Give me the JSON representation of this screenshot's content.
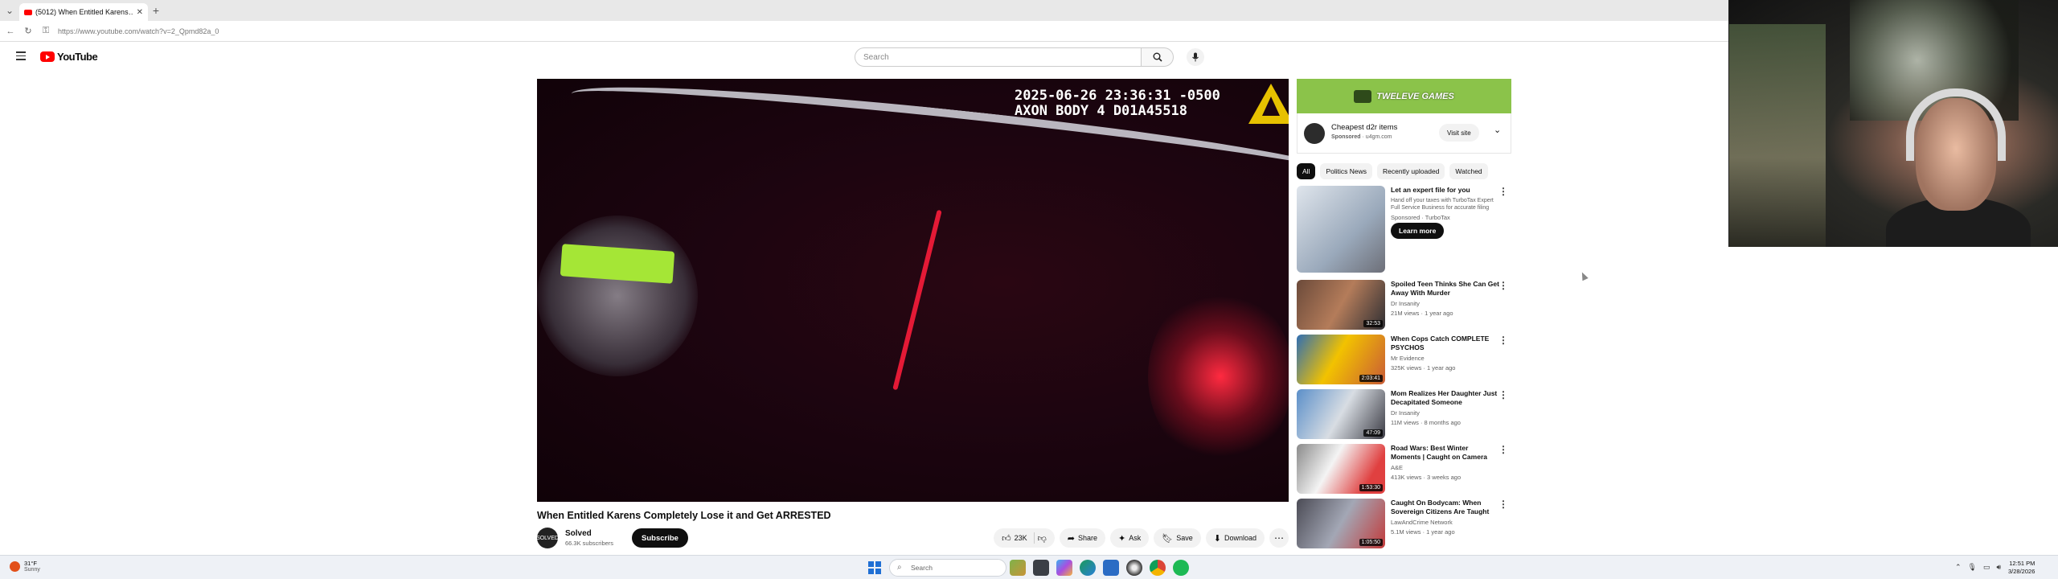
{
  "browser": {
    "tab_title": "(5012) When Entitled Karens…",
    "url": "https://www.youtube.com/watch?v=2_Qpmd82a_0"
  },
  "header": {
    "brand": "YouTube",
    "search_placeholder": "Search"
  },
  "video": {
    "overlay_line1": "2025-06-26 23:36:31 -0500",
    "overlay_line2": "AXON BODY 4 D01A45518",
    "title": "When Entitled Karens Completely Lose it and Get ARRESTED",
    "channel_avatar_text": "SOLVED",
    "channel": "Solved",
    "subscribers": "66.3K subscribers",
    "subscribe_label": "Subscribe",
    "likes": "23K",
    "share_label": "Share",
    "ask_label": "Ask",
    "save_label": "Save",
    "download_label": "Download"
  },
  "ad": {
    "banner_text": "TWELEVE GAMES",
    "title": "Cheapest d2r items",
    "sponsored": "Sponsored",
    "domain": "u4gm.com",
    "visit_label": "Visit site"
  },
  "chips": [
    "All",
    "Politics News",
    "Recently uploaded",
    "Watched"
  ],
  "recommendations": [
    {
      "title": "Let an expert file for you",
      "desc": "Hand off your taxes with TurboTax Expert Full Service Business for accurate filing",
      "channel": "Sponsored · TurboTax",
      "meta": "",
      "duration": "",
      "cta": "Learn more"
    },
    {
      "title": "Spoiled Teen Thinks She Can Get Away With Murder",
      "channel": "Dr Insanity",
      "meta": "21M views · 1 year ago",
      "duration": "32:53"
    },
    {
      "title": "When Cops Catch COMPLETE PSYCHOS",
      "channel": "Mr Evidence",
      "meta": "325K views · 1 year ago",
      "duration": "2:03:41"
    },
    {
      "title": "Mom Realizes Her Daughter Just Decapitated Someone",
      "channel": "Dr Insanity",
      "meta": "11M views · 8 months ago",
      "duration": "47:09"
    },
    {
      "title": "Road Wars: Best Winter Moments | Caught on Camera",
      "channel": "A&E",
      "meta": "413K views · 3 weeks ago",
      "duration": "1:53:30"
    },
    {
      "title": "Caught On Bodycam: When Sovereign Citizens Are Taught",
      "channel": "LawAndCrime Network",
      "meta": "5.1M views · 1 year ago",
      "duration": "1:05:50"
    }
  ],
  "taskbar": {
    "temp": "31°F",
    "weather": "Sunny",
    "search_placeholder": "Search",
    "time": "12:51 PM",
    "date": "3/28/2026"
  }
}
